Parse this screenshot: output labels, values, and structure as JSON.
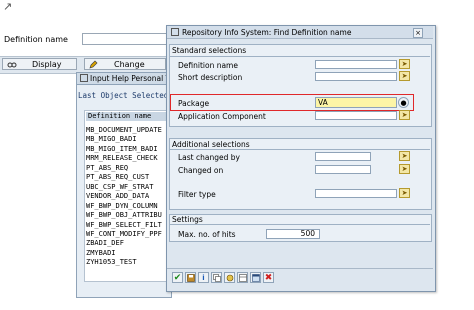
{
  "background": {
    "definition_name_label": "Definition name",
    "display_button": "Display",
    "change_button": "Change"
  },
  "input_help": {
    "title": "Input Help Personal Va",
    "header": "Last Object Selected",
    "column": "Definition name",
    "rows": [
      "MB_DOCUMENT_UPDATE",
      "MB_MIGO_BADI",
      "MB_MIGO_ITEM_BADI",
      "MRM_RELEASE_CHECK",
      "PT_ABS_REQ",
      "PT_ABS_REQ_CUST",
      "UBC_CSP_WF_STRAT",
      "VENDOR_ADD_DATA",
      "WF_BWP_DYN_COLUMN",
      "WF_BWP_OBJ_ATTRIBU",
      "WF_BWP_SELECT_FILT",
      "WF_CONT_MODIFY_PPF",
      "ZBADI_DEF",
      "ZMYBADI",
      "ZYH1053_TEST"
    ]
  },
  "dialog": {
    "title": "Repository Info System: Find Definition name",
    "standard_selections": "Standard selections",
    "definition_name_label": "Definition name",
    "short_description_label": "Short description",
    "package_label": "Package",
    "package_value": "VA",
    "application_component_label": "Application Component",
    "additional_selections": "Additional selections",
    "last_changed_by_label": "Last changed by",
    "changed_on_label": "Changed on",
    "filter_type_label": "Filter type",
    "settings": "Settings",
    "max_hits_label": "Max. no. of hits",
    "max_hits_value": "500"
  },
  "colors": {
    "highlight": "#e0282a",
    "title_bar": "#d3deea",
    "panel": "#dde6ef"
  }
}
